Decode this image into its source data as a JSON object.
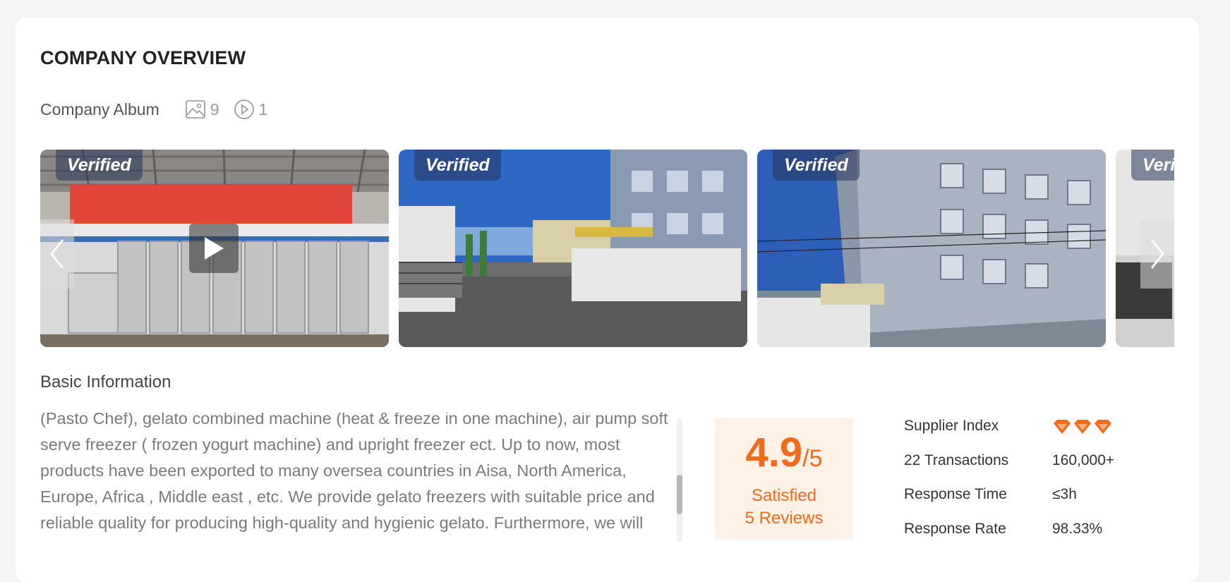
{
  "section": {
    "title": "COMPANY OVERVIEW"
  },
  "album": {
    "label": "Company Album",
    "photo_count": "9",
    "video_count": "1",
    "photo_icon": "image-icon",
    "video_icon": "play-circle-icon",
    "verified_label": "Verified",
    "verified_partial": "Veri"
  },
  "basic_info": {
    "title": "Basic Information",
    "description": "(Pasto Chef), gelato combined machine (heat & freeze in one machine), air pump soft serve freezer ( frozen yogurt machine) and upright freezer ect. Up to now, most products have been exported to many oversea countries in Aisa, North America, Europe, Africa , Middle east , etc. We provide gelato freezers with suitable price and reliable quality for producing high-quality and hygienic gelato. Furthermore, we will"
  },
  "rating": {
    "score": "4.9",
    "out_of": "/5",
    "label": "Satisfied",
    "reviews": "5 Reviews"
  },
  "info": {
    "supplier_index_label": "Supplier Index",
    "supplier_index_level": 3,
    "transactions_label": "22 Transactions",
    "transactions_value": "160,000+",
    "response_time_label": "Response Time",
    "response_time_value": "≤3h",
    "response_rate_label": "Response Rate",
    "response_rate_value": "98.33%"
  },
  "colors": {
    "accent": "#f26a1b",
    "rating_bg": "#fff1e6"
  }
}
